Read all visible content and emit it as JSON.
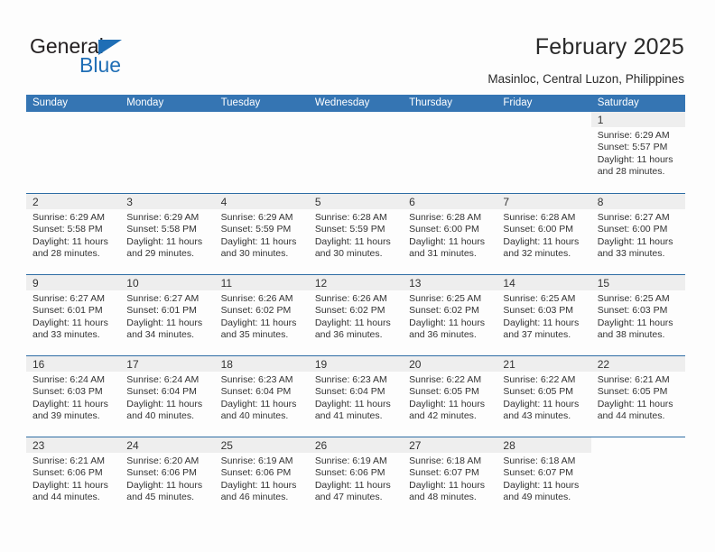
{
  "brand": {
    "name_top": "General",
    "name_bottom": "Blue",
    "triangle_color": "#1f6eb5",
    "text_color": "#231f20"
  },
  "header": {
    "title": "February 2025",
    "subtitle": "Masinloc, Central Luzon, Philippines"
  },
  "colors": {
    "header_blue": "#3575b3",
    "row_divider": "#2e6da4",
    "daynum_band": "#eeeeee",
    "page_background": "#fdfdfd",
    "text": "#333333"
  },
  "calendar": {
    "day_headers": [
      "Sunday",
      "Monday",
      "Tuesday",
      "Wednesday",
      "Thursday",
      "Friday",
      "Saturday"
    ],
    "weeks": [
      [
        {
          "day": "",
          "lines": []
        },
        {
          "day": "",
          "lines": []
        },
        {
          "day": "",
          "lines": []
        },
        {
          "day": "",
          "lines": []
        },
        {
          "day": "",
          "lines": []
        },
        {
          "day": "",
          "lines": []
        },
        {
          "day": "1",
          "lines": [
            "Sunrise: 6:29 AM",
            "Sunset: 5:57 PM",
            "Daylight: 11 hours",
            "and 28 minutes."
          ]
        }
      ],
      [
        {
          "day": "2",
          "lines": [
            "Sunrise: 6:29 AM",
            "Sunset: 5:58 PM",
            "Daylight: 11 hours",
            "and 28 minutes."
          ]
        },
        {
          "day": "3",
          "lines": [
            "Sunrise: 6:29 AM",
            "Sunset: 5:58 PM",
            "Daylight: 11 hours",
            "and 29 minutes."
          ]
        },
        {
          "day": "4",
          "lines": [
            "Sunrise: 6:29 AM",
            "Sunset: 5:59 PM",
            "Daylight: 11 hours",
            "and 30 minutes."
          ]
        },
        {
          "day": "5",
          "lines": [
            "Sunrise: 6:28 AM",
            "Sunset: 5:59 PM",
            "Daylight: 11 hours",
            "and 30 minutes."
          ]
        },
        {
          "day": "6",
          "lines": [
            "Sunrise: 6:28 AM",
            "Sunset: 6:00 PM",
            "Daylight: 11 hours",
            "and 31 minutes."
          ]
        },
        {
          "day": "7",
          "lines": [
            "Sunrise: 6:28 AM",
            "Sunset: 6:00 PM",
            "Daylight: 11 hours",
            "and 32 minutes."
          ]
        },
        {
          "day": "8",
          "lines": [
            "Sunrise: 6:27 AM",
            "Sunset: 6:00 PM",
            "Daylight: 11 hours",
            "and 33 minutes."
          ]
        }
      ],
      [
        {
          "day": "9",
          "lines": [
            "Sunrise: 6:27 AM",
            "Sunset: 6:01 PM",
            "Daylight: 11 hours",
            "and 33 minutes."
          ]
        },
        {
          "day": "10",
          "lines": [
            "Sunrise: 6:27 AM",
            "Sunset: 6:01 PM",
            "Daylight: 11 hours",
            "and 34 minutes."
          ]
        },
        {
          "day": "11",
          "lines": [
            "Sunrise: 6:26 AM",
            "Sunset: 6:02 PM",
            "Daylight: 11 hours",
            "and 35 minutes."
          ]
        },
        {
          "day": "12",
          "lines": [
            "Sunrise: 6:26 AM",
            "Sunset: 6:02 PM",
            "Daylight: 11 hours",
            "and 36 minutes."
          ]
        },
        {
          "day": "13",
          "lines": [
            "Sunrise: 6:25 AM",
            "Sunset: 6:02 PM",
            "Daylight: 11 hours",
            "and 36 minutes."
          ]
        },
        {
          "day": "14",
          "lines": [
            "Sunrise: 6:25 AM",
            "Sunset: 6:03 PM",
            "Daylight: 11 hours",
            "and 37 minutes."
          ]
        },
        {
          "day": "15",
          "lines": [
            "Sunrise: 6:25 AM",
            "Sunset: 6:03 PM",
            "Daylight: 11 hours",
            "and 38 minutes."
          ]
        }
      ],
      [
        {
          "day": "16",
          "lines": [
            "Sunrise: 6:24 AM",
            "Sunset: 6:03 PM",
            "Daylight: 11 hours",
            "and 39 minutes."
          ]
        },
        {
          "day": "17",
          "lines": [
            "Sunrise: 6:24 AM",
            "Sunset: 6:04 PM",
            "Daylight: 11 hours",
            "and 40 minutes."
          ]
        },
        {
          "day": "18",
          "lines": [
            "Sunrise: 6:23 AM",
            "Sunset: 6:04 PM",
            "Daylight: 11 hours",
            "and 40 minutes."
          ]
        },
        {
          "day": "19",
          "lines": [
            "Sunrise: 6:23 AM",
            "Sunset: 6:04 PM",
            "Daylight: 11 hours",
            "and 41 minutes."
          ]
        },
        {
          "day": "20",
          "lines": [
            "Sunrise: 6:22 AM",
            "Sunset: 6:05 PM",
            "Daylight: 11 hours",
            "and 42 minutes."
          ]
        },
        {
          "day": "21",
          "lines": [
            "Sunrise: 6:22 AM",
            "Sunset: 6:05 PM",
            "Daylight: 11 hours",
            "and 43 minutes."
          ]
        },
        {
          "day": "22",
          "lines": [
            "Sunrise: 6:21 AM",
            "Sunset: 6:05 PM",
            "Daylight: 11 hours",
            "and 44 minutes."
          ]
        }
      ],
      [
        {
          "day": "23",
          "lines": [
            "Sunrise: 6:21 AM",
            "Sunset: 6:06 PM",
            "Daylight: 11 hours",
            "and 44 minutes."
          ]
        },
        {
          "day": "24",
          "lines": [
            "Sunrise: 6:20 AM",
            "Sunset: 6:06 PM",
            "Daylight: 11 hours",
            "and 45 minutes."
          ]
        },
        {
          "day": "25",
          "lines": [
            "Sunrise: 6:19 AM",
            "Sunset: 6:06 PM",
            "Daylight: 11 hours",
            "and 46 minutes."
          ]
        },
        {
          "day": "26",
          "lines": [
            "Sunrise: 6:19 AM",
            "Sunset: 6:06 PM",
            "Daylight: 11 hours",
            "and 47 minutes."
          ]
        },
        {
          "day": "27",
          "lines": [
            "Sunrise: 6:18 AM",
            "Sunset: 6:07 PM",
            "Daylight: 11 hours",
            "and 48 minutes."
          ]
        },
        {
          "day": "28",
          "lines": [
            "Sunrise: 6:18 AM",
            "Sunset: 6:07 PM",
            "Daylight: 11 hours",
            "and 49 minutes."
          ]
        },
        {
          "day": "",
          "lines": []
        }
      ]
    ]
  }
}
